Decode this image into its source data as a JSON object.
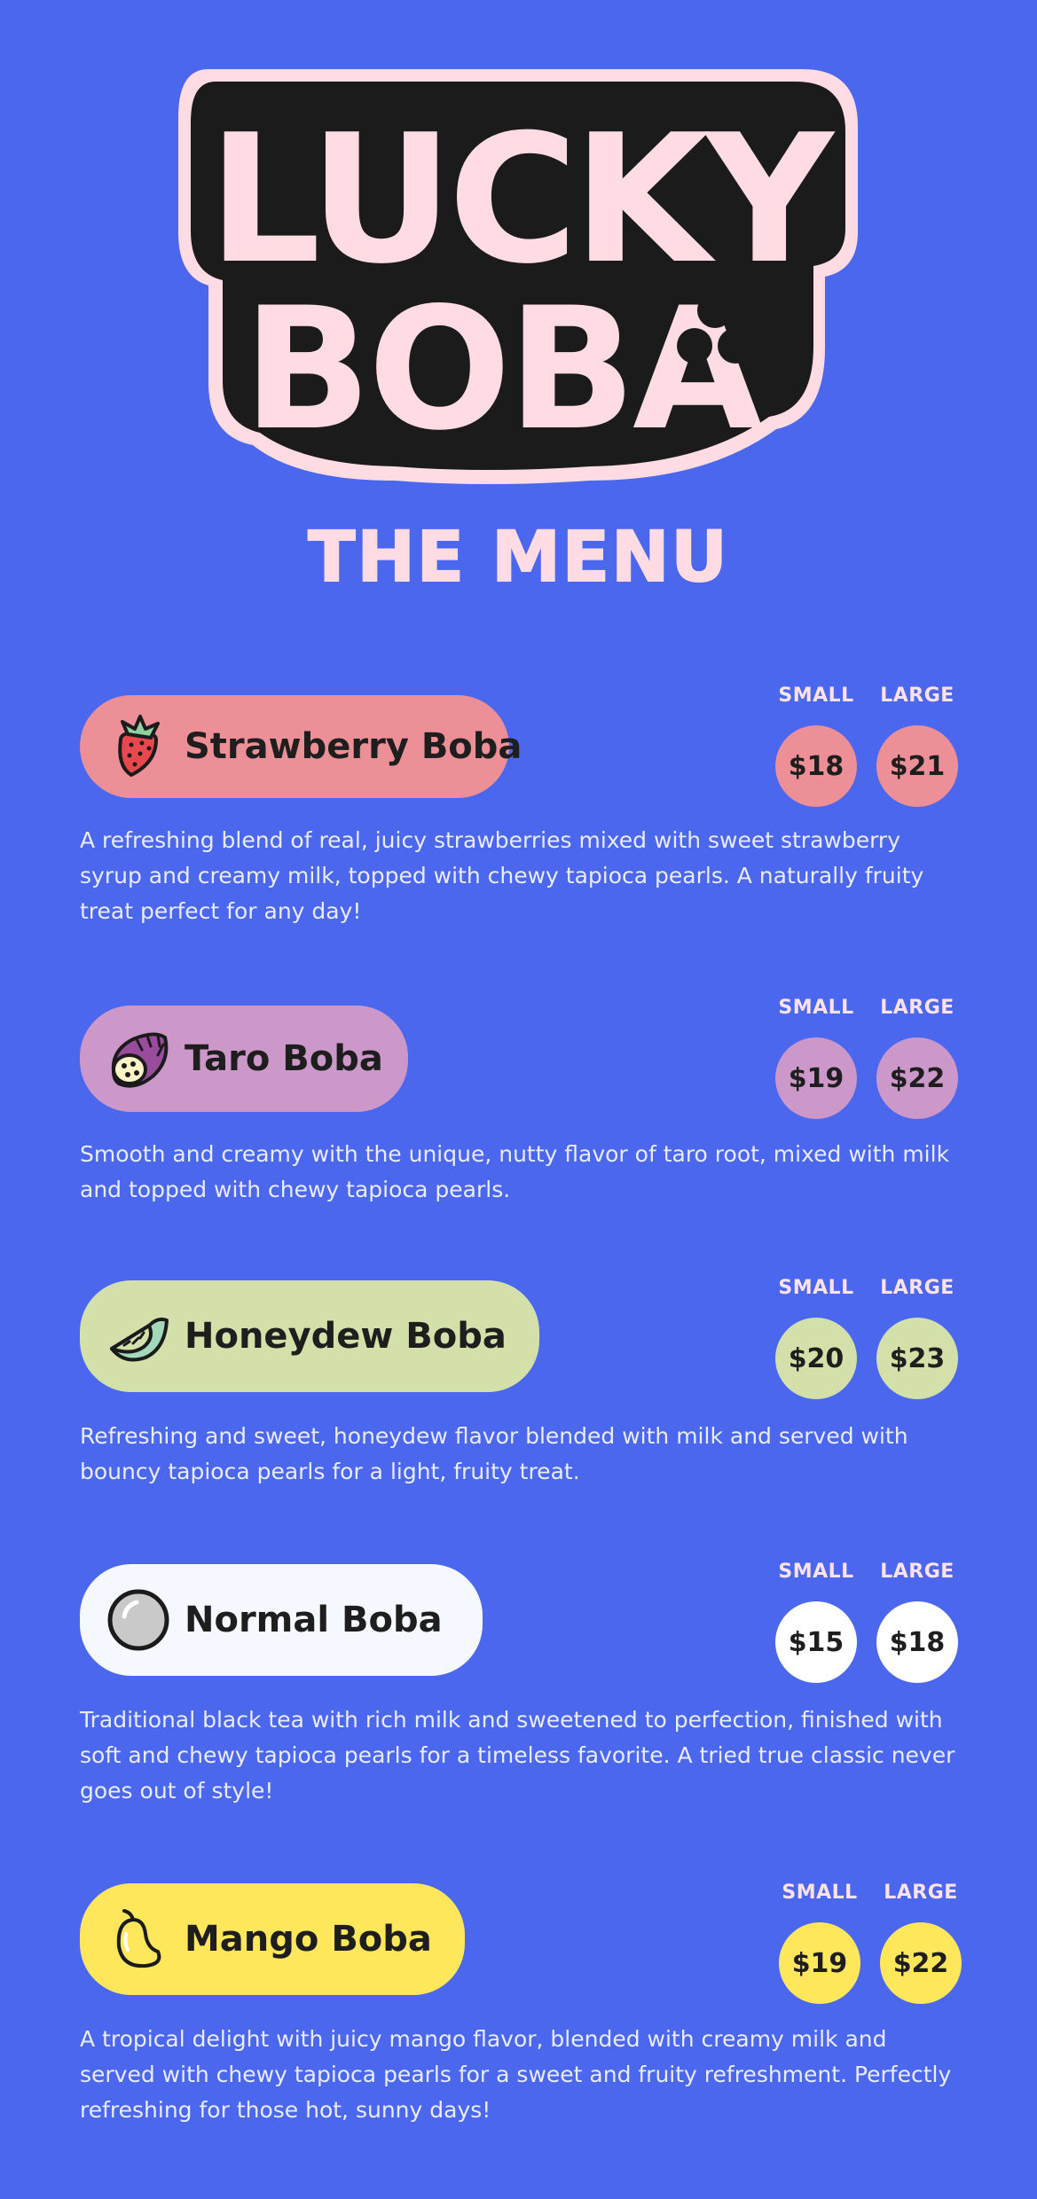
{
  "logo": {
    "line1": "LUCKY",
    "line2": "BOBA"
  },
  "menu_title": "THE MENU",
  "size_labels": {
    "small": "SMALL",
    "large": "LARGE"
  },
  "items": [
    {
      "name": "Strawberry Boba",
      "icon": "strawberry-icon",
      "color": "#ec8f97",
      "price_small": "$18",
      "price_large": "$21",
      "description": "A refreshing blend of real, juicy strawberries mixed with sweet strawberry syrup and creamy milk, topped with chewy tapioca pearls. A naturally fruity treat perfect for any day!"
    },
    {
      "name": "Taro Boba",
      "icon": "taro-icon",
      "color": "#cc98c9",
      "price_small": "$19",
      "price_large": "$22",
      "description": "Smooth and creamy with the unique, nutty flavor of taro root, mixed with milk and topped with chewy tapioca pearls."
    },
    {
      "name": "Honeydew Boba",
      "icon": "honeydew-icon",
      "color": "#d4e0a9",
      "price_small": "$20",
      "price_large": "$23",
      "description": "Refreshing and sweet, honeydew flavor blended with milk and served with bouncy tapioca pearls for a light, fruity treat."
    },
    {
      "name": "Normal Boba",
      "icon": "boba-pearl-icon",
      "color": "#f5f9ff",
      "price_small": "$15",
      "price_large": "$18",
      "description": "Traditional black tea with rich milk and sweetened to perfection, finished with soft and chewy tapioca pearls for a timeless favorite. A tried true classic never goes out of style!"
    },
    {
      "name": "Mango Boba",
      "icon": "mango-icon",
      "color": "#ffe75c",
      "price_small": "$19",
      "price_large": "$22",
      "description": "A tropical delight with juicy mango flavor, blended with creamy milk and served with chewy tapioca pearls for a sweet and fruity refreshment. Perfectly refreshing for those hot, sunny days!"
    }
  ],
  "colors": {
    "background": "#4a67ee",
    "logo_fill": "#ffdbe4",
    "logo_outline": "#1b1b1b"
  }
}
